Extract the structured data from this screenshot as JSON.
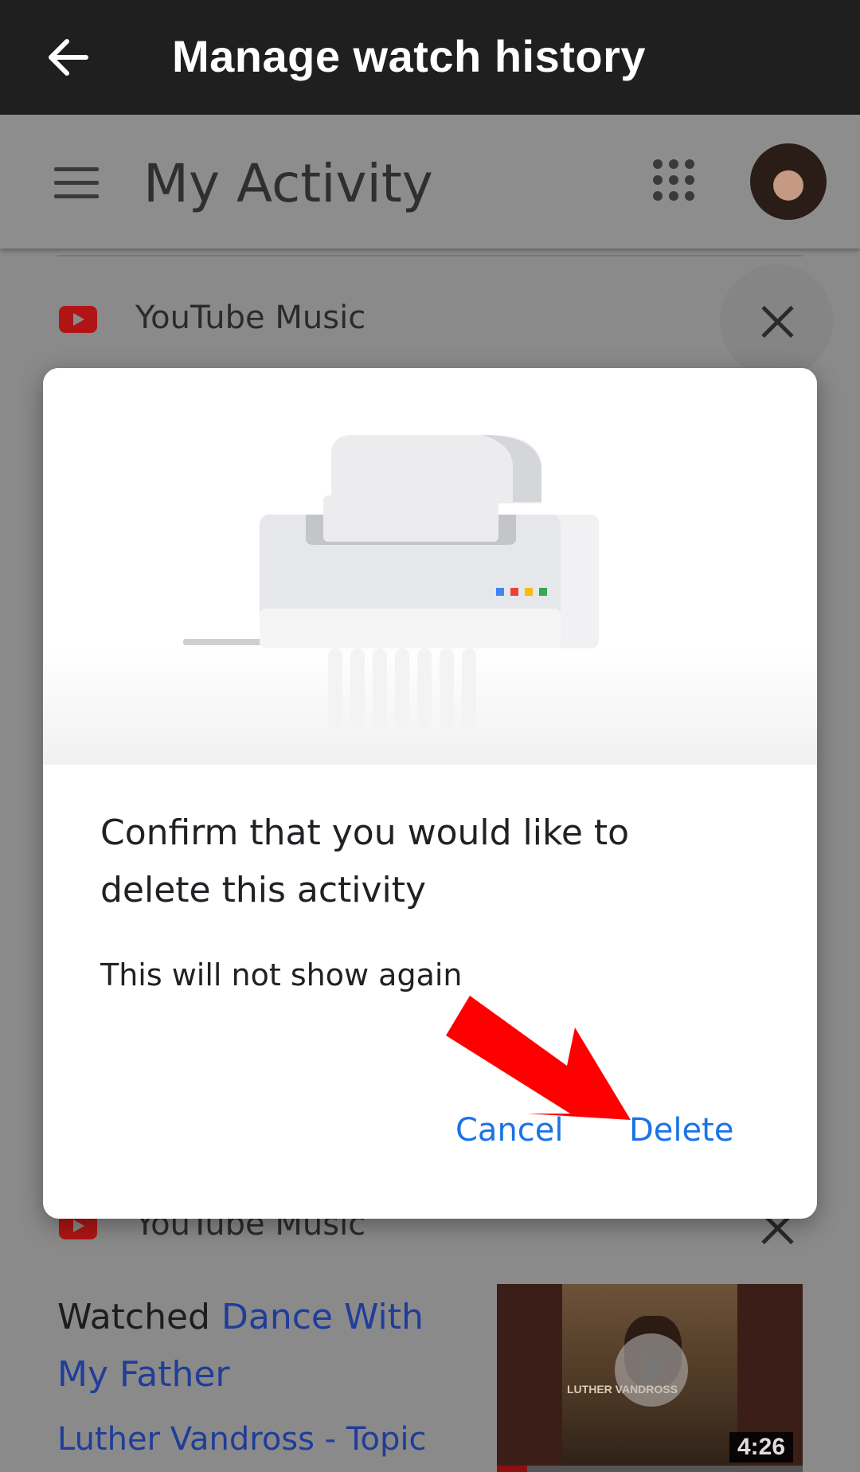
{
  "topbar": {
    "title": "Manage watch history",
    "back_icon": "arrow-left-icon"
  },
  "appbar": {
    "title": "My Activity",
    "menu_icon": "hamburger-icon",
    "apps_icon": "apps-grid-icon"
  },
  "activity_items": [
    {
      "product": "YouTube Music"
    },
    {
      "product": "YouTube Music",
      "watched_prefix": "Watched",
      "video_title": "Dance With My Father",
      "channel": "Luther Vandross - Topic",
      "thumbnail_text": "LUTHER VANDROSS",
      "duration": "4:26",
      "progress": 0.1
    }
  ],
  "dialog": {
    "title": "Confirm that you would like to delete this activity",
    "body": "This will not show again",
    "cancel_label": "Cancel",
    "delete_label": "Delete",
    "illustration": "paper-shredder-illustration"
  },
  "colors": {
    "topbar_bg": "#1f1f1f",
    "link_blue": "#1a73e8",
    "arrow_red": "#ff0000",
    "youtube_red": "#b01515"
  },
  "annotation": "red-arrow-pointing-to-delete"
}
